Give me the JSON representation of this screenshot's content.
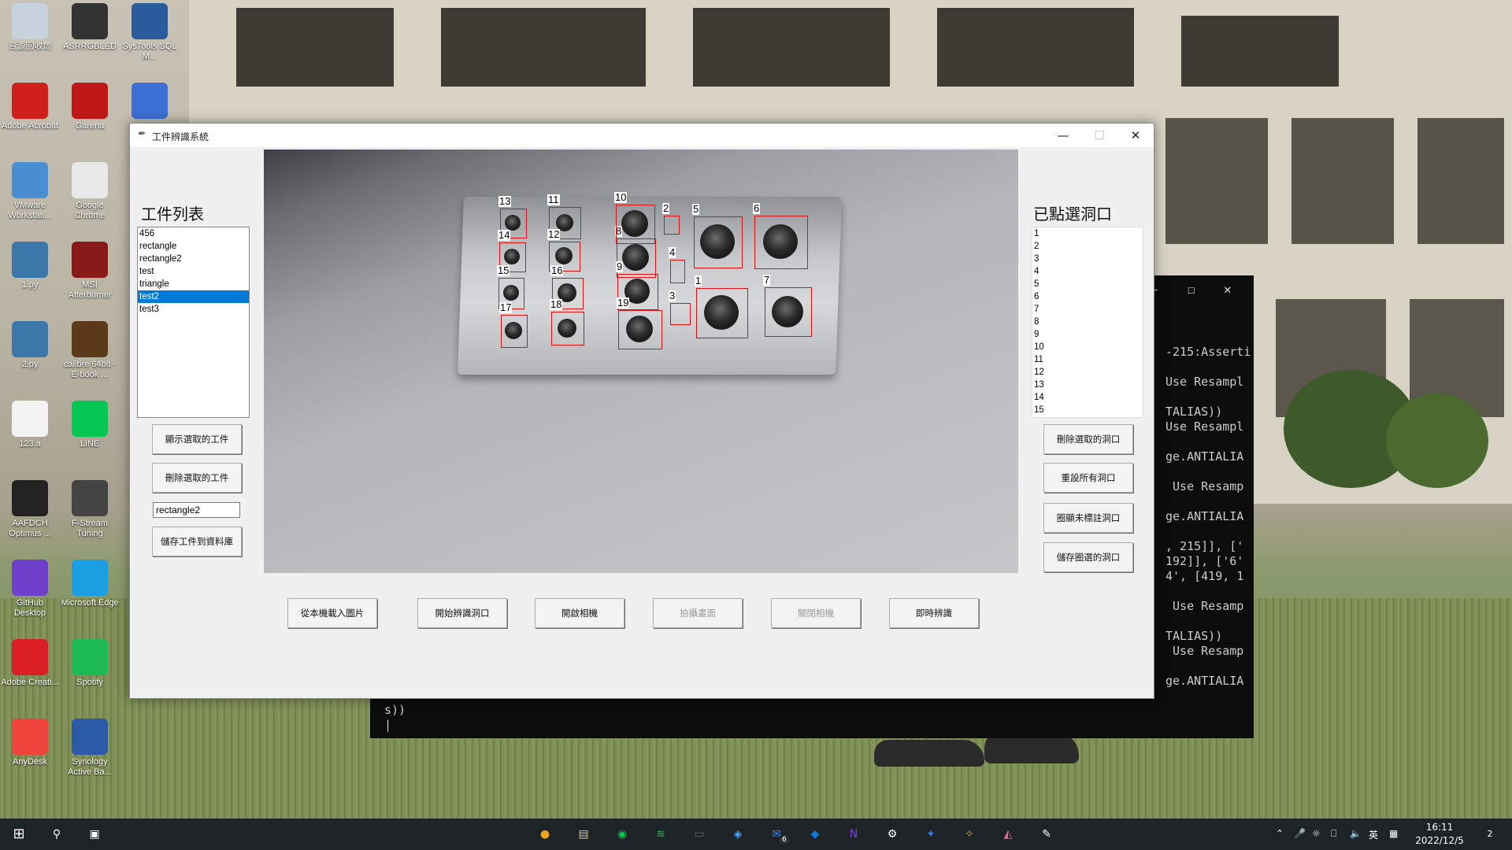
{
  "desktop": {
    "icons": [
      {
        "label": "資源回收筒",
        "color": "#c8d2dc"
      },
      {
        "label": "ASRRGBLED",
        "color": "#333333"
      },
      {
        "label": "SysTools SQL M...",
        "color": "#2a5b9a"
      },
      {
        "label": "Adobe Acrobat",
        "color": "#d0201c"
      },
      {
        "label": "Garena",
        "color": "#c01818"
      },
      {
        "label": "",
        "color": "#3d6fd6"
      },
      {
        "label": "VMware Workstati...",
        "color": "#4a8fd1"
      },
      {
        "label": "Google Chrome",
        "color": "#e8e8e8"
      },
      {
        "label": "1.py",
        "color": "#3b77a8"
      },
      {
        "label": "MSI Afterburner",
        "color": "#8a1a1a"
      },
      {
        "label": "2.py",
        "color": "#3b77a8"
      },
      {
        "label": "calibre 64bit - E-book ...",
        "color": "#5a3a1a"
      },
      {
        "label": "123.a",
        "color": "#f2f2f2"
      },
      {
        "label": "LINE",
        "color": "#06c755"
      },
      {
        "label": "AAFDCH Optimus ...",
        "color": "#222222"
      },
      {
        "label": "F-Stream Tuning",
        "color": "#444444"
      },
      {
        "label": "GitHub Desktop",
        "color": "#6e40c9"
      },
      {
        "label": "Microsoft Edge",
        "color": "#1b9de2"
      },
      {
        "label": "Adobe Creati...",
        "color": "#da1f26"
      },
      {
        "label": "Spotify",
        "color": "#1db954"
      },
      {
        "label": "AnyDesk",
        "color": "#ef443b"
      },
      {
        "label": "Synology Active Ba...",
        "color": "#2b5aa6"
      }
    ]
  },
  "console": {
    "title_buttons": [
      "—",
      "☐",
      "✕"
    ],
    "lines": [
      "-215:Asserti",
      "",
      "Use Resampl",
      "",
      "TALIAS))",
      "Use Resampl",
      "",
      "ge.ANTIALIA",
      "",
      " Use Resamp",
      "",
      "ge.ANTIALIA",
      "",
      ", 215]], ['",
      "192]], ['6'",
      "4', [419, 1",
      "",
      " Use Resamp",
      "",
      "TALIAS))",
      " Use Resamp",
      "",
      "ge.ANTIALIA"
    ],
    "bottom_lines": [
      "s))",
      "|"
    ]
  },
  "app": {
    "title": "工件辨識系統",
    "window_buttons": [
      "—",
      "☐",
      "✕"
    ],
    "parts_heading": "工件列表",
    "parts": [
      "456",
      "rectangle",
      "rectangle2",
      "test",
      "triangle",
      "test2",
      "test3"
    ],
    "selected_part": "test2",
    "show_part_btn": "顯示選取的工件",
    "delete_part_btn": "刪除選取的工件",
    "part_name_value": "rectangle2",
    "save_part_btn": "儲存工件到資料庫",
    "holes_heading": "已點選洞口",
    "holes": [
      "1",
      "2",
      "3",
      "4",
      "5",
      "6",
      "7",
      "8",
      "9",
      "10",
      "11",
      "12",
      "13",
      "14",
      "15"
    ],
    "delete_hole_btn": "刪除選取的洞口",
    "reset_holes_btn": "重設所有洞口",
    "show_unmarked_btn": "圈顯未標註洞口",
    "save_selected_btn": "儲存圈選的洞口",
    "bottom_buttons": [
      {
        "label": "從本機載入圖片",
        "enabled": true
      },
      {
        "label": "開始辨識洞口",
        "enabled": true
      },
      {
        "label": "開啟相機",
        "enabled": true
      },
      {
        "label": "拍攝畫面",
        "enabled": false
      },
      {
        "label": "關閉相機",
        "enabled": false
      },
      {
        "label": "即時辨識",
        "enabled": true
      }
    ],
    "hole_labels": [
      "1",
      "2",
      "3",
      "4",
      "5",
      "6",
      "7",
      "8",
      "9",
      "10",
      "11",
      "12",
      "13",
      "14",
      "15",
      "16",
      "17",
      "18",
      "19"
    ]
  },
  "taskbar": {
    "apps": [
      "Chrome",
      "File Explorer",
      "LINE",
      "Spotify",
      "Terminal",
      "Copilot",
      "Mail",
      "VS Code",
      "Visual Studio",
      "Settings",
      "App",
      "Python",
      "App",
      "Feather"
    ],
    "mail_badge": "6",
    "ime": "英",
    "time": "16:11",
    "date": "2022/12/5",
    "notif_count": "2"
  },
  "colors": {
    "accent": "#0078d7",
    "box": "#e01010",
    "taskbar": "#1d2326"
  }
}
